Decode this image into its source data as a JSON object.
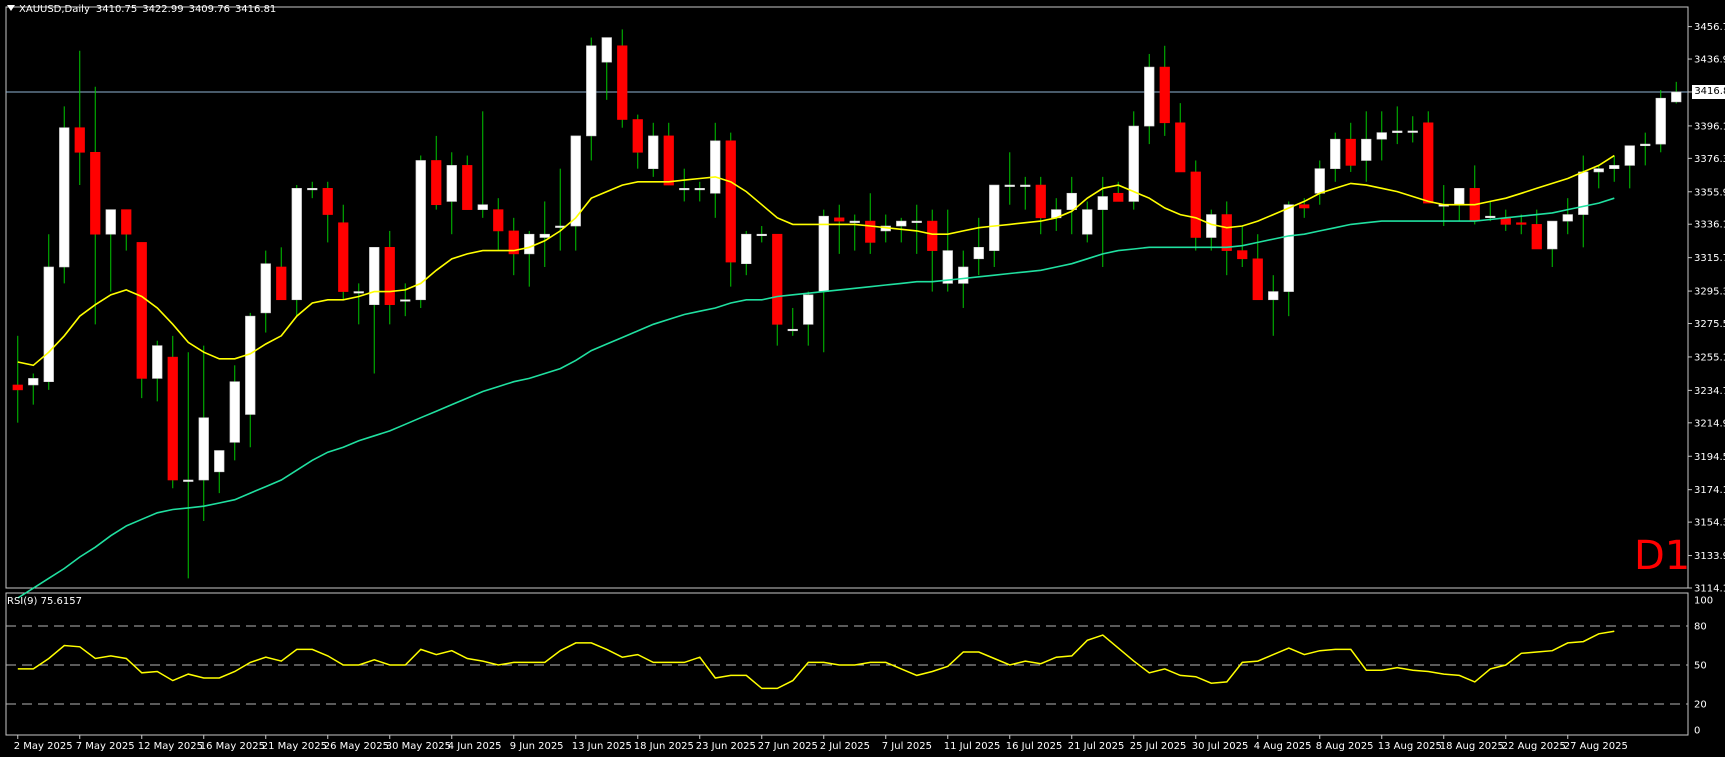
{
  "header": {
    "symbol": "XAUUSD,Daily",
    "open": "3410.75",
    "high": "3422.99",
    "low": "3409.76",
    "close": "3416.81"
  },
  "timeframe_label": "D1",
  "last_price_label": "3416.81",
  "rsi_header": "RSI(9) 75.6157",
  "colors": {
    "background": "#000000",
    "bull_candle": "#ffffff",
    "bear_candle": "#ff0000",
    "wick": "#00c800",
    "ma_fast": "#ffff00",
    "ma_slow": "#20e0a0",
    "rsi_line": "#ffff00",
    "grid_dash": "#b4b4b4",
    "price_line": "#8fb5d5"
  },
  "chart_data": [
    {
      "type": "candlestick",
      "title": "XAUUSD,Daily",
      "ylim": [
        3114.1,
        3465.0
      ],
      "y_ticks": [
        "3456.70",
        "3436.90",
        "3416.81",
        "3396.10",
        "3376.30",
        "3355.90",
        "3336.10",
        "3315.70",
        "3295.30",
        "3275.50",
        "3255.10",
        "3234.70",
        "3214.90",
        "3194.50",
        "3174.10",
        "3154.30",
        "3133.90",
        "3114.10"
      ],
      "x_labels": [
        "2 May 2025",
        "7 May 2025",
        "12 May 2025",
        "16 May 2025",
        "21 May 2025",
        "26 May 2025",
        "30 May 2025",
        "4 Jun 2025",
        "9 Jun 2025",
        "13 Jun 2025",
        "18 Jun 2025",
        "23 Jun 2025",
        "27 Jun 2025",
        "2 Jul 2025",
        "7 Jul 2025",
        "11 Jul 2025",
        "16 Jul 2025",
        "21 Jul 2025",
        "25 Jul 2025",
        "30 Jul 2025",
        "4 Aug 2025",
        "8 Aug 2025",
        "13 Aug 2025",
        "18 Aug 2025",
        "22 Aug 2025",
        "27 Aug 2025"
      ],
      "x_label_bar_index": [
        0,
        4,
        8,
        12,
        16,
        20,
        24,
        28,
        32,
        36,
        40,
        44,
        48,
        52,
        56,
        60,
        64,
        68,
        72,
        76,
        80,
        84,
        88,
        92,
        96,
        100
      ],
      "series": [
        {
          "name": "XAUUSD",
          "ohlc": [
            [
              3238,
              3268,
              3215,
              3235
            ],
            [
              3238,
              3245,
              3226,
              3242
            ],
            [
              3240,
              3330,
              3235,
              3310
            ],
            [
              3310,
              3408,
              3300,
              3395
            ],
            [
              3395,
              3442,
              3360,
              3380
            ],
            [
              3380,
              3420,
              3275,
              3330
            ],
            [
              3330,
              3345,
              3295,
              3345
            ],
            [
              3345,
              3345,
              3320,
              3330
            ],
            [
              3325,
              3325,
              3230,
              3242
            ],
            [
              3242,
              3265,
              3228,
              3262
            ],
            [
              3255,
              3268,
              3175,
              3180
            ],
            [
              3180,
              3258,
              3120,
              3180
            ],
            [
              3180,
              3262,
              3155,
              3218
            ],
            [
              3185,
              3198,
              3172,
              3198
            ],
            [
              3203,
              3250,
              3192,
              3240
            ],
            [
              3220,
              3282,
              3200,
              3280
            ],
            [
              3282,
              3320,
              3270,
              3312
            ],
            [
              3310,
              3322,
              3290,
              3290
            ],
            [
              3290,
              3360,
              3280,
              3358
            ],
            [
              3358,
              3362,
              3352,
              3358
            ],
            [
              3358,
              3362,
              3325,
              3342
            ],
            [
              3337,
              3348,
              3290,
              3295
            ],
            [
              3295,
              3300,
              3275,
              3295
            ],
            [
              3287,
              3322,
              3245,
              3322
            ],
            [
              3322,
              3332,
              3275,
              3287
            ],
            [
              3290,
              3300,
              3280,
              3290
            ],
            [
              3290,
              3378,
              3285,
              3375
            ],
            [
              3375,
              3390,
              3345,
              3348
            ],
            [
              3350,
              3380,
              3330,
              3372
            ],
            [
              3372,
              3378,
              3345,
              3345
            ],
            [
              3345,
              3405,
              3340,
              3348
            ],
            [
              3345,
              3352,
              3320,
              3332
            ],
            [
              3332,
              3340,
              3305,
              3318
            ],
            [
              3318,
              3332,
              3298,
              3330
            ],
            [
              3328,
              3350,
              3310,
              3330
            ],
            [
              3335,
              3370,
              3320,
              3335
            ],
            [
              3335,
              3390,
              3320,
              3390
            ],
            [
              3390,
              3450,
              3375,
              3445
            ],
            [
              3435,
              3445,
              3412,
              3450
            ],
            [
              3445,
              3455,
              3395,
              3400
            ],
            [
              3400,
              3403,
              3370,
              3380
            ],
            [
              3370,
              3398,
              3365,
              3390
            ],
            [
              3390,
              3398,
              3360,
              3360
            ],
            [
              3358,
              3370,
              3350,
              3358
            ],
            [
              3358,
              3362,
              3350,
              3358
            ],
            [
              3355,
              3398,
              3340,
              3387
            ],
            [
              3387,
              3392,
              3298,
              3313
            ],
            [
              3312,
              3332,
              3305,
              3330
            ],
            [
              3330,
              3335,
              3325,
              3330
            ],
            [
              3330,
              3330,
              3262,
              3275
            ],
            [
              3272,
              3285,
              3268,
              3272
            ],
            [
              3275,
              3295,
              3262,
              3293
            ],
            [
              3295,
              3345,
              3258,
              3341
            ],
            [
              3340,
              3348,
              3318,
              3338
            ],
            [
              3338,
              3342,
              3320,
              3338
            ],
            [
              3338,
              3355,
              3318,
              3325
            ],
            [
              3332,
              3342,
              3325,
              3335
            ],
            [
              3335,
              3340,
              3325,
              3338
            ],
            [
              3338,
              3348,
              3318,
              3338
            ],
            [
              3338,
              3345,
              3295,
              3320
            ],
            [
              3300,
              3345,
              3295,
              3320
            ],
            [
              3300,
              3320,
              3285,
              3310
            ],
            [
              3315,
              3340,
              3305,
              3322
            ],
            [
              3320,
              3350,
              3310,
              3360
            ],
            [
              3360,
              3380,
              3348,
              3360
            ],
            [
              3360,
              3365,
              3345,
              3360
            ],
            [
              3360,
              3365,
              3330,
              3340
            ],
            [
              3340,
              3352,
              3332,
              3345
            ],
            [
              3345,
              3365,
              3330,
              3355
            ],
            [
              3330,
              3350,
              3325,
              3345
            ],
            [
              3345,
              3365,
              3310,
              3353
            ],
            [
              3355,
              3362,
              3350,
              3350
            ],
            [
              3350,
              3405,
              3345,
              3396
            ],
            [
              3396,
              3440,
              3385,
              3432
            ],
            [
              3432,
              3445,
              3390,
              3398
            ],
            [
              3398,
              3410,
              3380,
              3368
            ],
            [
              3368,
              3375,
              3320,
              3328
            ],
            [
              3328,
              3345,
              3320,
              3342
            ],
            [
              3342,
              3350,
              3305,
              3320
            ],
            [
              3320,
              3335,
              3310,
              3315
            ],
            [
              3315,
              3330,
              3295,
              3290
            ],
            [
              3290,
              3305,
              3268,
              3295
            ],
            [
              3295,
              3350,
              3280,
              3348
            ],
            [
              3348,
              3352,
              3340,
              3346
            ],
            [
              3355,
              3375,
              3348,
              3370
            ],
            [
              3370,
              3392,
              3362,
              3388
            ],
            [
              3388,
              3398,
              3368,
              3372
            ],
            [
              3375,
              3405,
              3362,
              3388
            ],
            [
              3388,
              3405,
              3375,
              3392
            ],
            [
              3392,
              3408,
              3385,
              3393
            ],
            [
              3393,
              3402,
              3386,
              3393
            ],
            [
              3398,
              3405,
              3350,
              3349
            ],
            [
              3348,
              3360,
              3335,
              3348
            ],
            [
              3348,
              3358,
              3338,
              3358
            ],
            [
              3358,
              3372,
              3336,
              3338
            ],
            [
              3341,
              3350,
              3338,
              3341
            ],
            [
              3340,
              3345,
              3332,
              3336
            ],
            [
              3337,
              3342,
              3330,
              3336
            ],
            [
              3336,
              3345,
              3322,
              3321
            ],
            [
              3321,
              3335,
              3310,
              3338
            ],
            [
              3338,
              3352,
              3330,
              3342
            ],
            [
              3342,
              3378,
              3322,
              3368
            ],
            [
              3368,
              3372,
              3358,
              3370
            ],
            [
              3370,
              3378,
              3362,
              3372
            ],
            [
              3372,
              3382,
              3358,
              3384
            ],
            [
              3384,
              3392,
              3372,
              3385
            ],
            [
              3385,
              3418,
              3380,
              3413
            ],
            [
              3410.75,
              3422.99,
              3409.76,
              3416.81
            ]
          ]
        },
        {
          "name": "MA fast",
          "values": [
            3252,
            3250,
            3258,
            3268,
            3280,
            3287,
            3293,
            3296,
            3292,
            3285,
            3275,
            3264,
            3258,
            3254,
            3254,
            3257,
            3263,
            3268,
            3280,
            3288,
            3290,
            3290,
            3292,
            3295,
            3295,
            3296,
            3300,
            3308,
            3315,
            3318,
            3320,
            3320,
            3320,
            3322,
            3326,
            3332,
            3340,
            3352,
            3356,
            3360,
            3362,
            3362,
            3362,
            3363,
            3364,
            3365,
            3362,
            3356,
            3348,
            3340,
            3336,
            3336,
            3336,
            3336,
            3336,
            3335,
            3334,
            3333,
            3332,
            3330,
            3330,
            3332,
            3334,
            3335,
            3336,
            3337,
            3338,
            3340,
            3344,
            3352,
            3358,
            3360,
            3356,
            3352,
            3346,
            3342,
            3340,
            3336,
            3334,
            3335,
            3338,
            3342,
            3346,
            3350,
            3355,
            3358,
            3361,
            3360,
            3358,
            3356,
            3353,
            3350,
            3348,
            3348,
            3348,
            3350,
            3352,
            3355,
            3358,
            3361,
            3364,
            3368,
            3372,
            3378
          ]
        },
        {
          "name": "MA slow",
          "values": [
            3108,
            3114,
            3120,
            3126,
            3133,
            3139,
            3146,
            3152,
            3156,
            3160,
            3162,
            3163,
            3164,
            3166,
            3168,
            3172,
            3176,
            3180,
            3186,
            3192,
            3197,
            3200,
            3204,
            3207,
            3210,
            3214,
            3218,
            3222,
            3226,
            3230,
            3234,
            3237,
            3240,
            3242,
            3245,
            3248,
            3253,
            3259,
            3263,
            3267,
            3271,
            3275,
            3278,
            3281,
            3283,
            3285,
            3288,
            3290,
            3290,
            3292,
            3293,
            3294,
            3295,
            3296,
            3297,
            3298,
            3299,
            3300,
            3301,
            3301,
            3302,
            3303,
            3304,
            3305,
            3306,
            3307,
            3308,
            3310,
            3312,
            3315,
            3318,
            3320,
            3321,
            3322,
            3322,
            3322,
            3322,
            3322,
            3322,
            3323,
            3325,
            3327,
            3329,
            3330,
            3332,
            3334,
            3336,
            3337,
            3338,
            3338,
            3338,
            3338,
            3338,
            3338,
            3338,
            3339,
            3340,
            3341,
            3342,
            3343,
            3345,
            3347,
            3349,
            3352
          ]
        }
      ]
    },
    {
      "type": "line",
      "title": "RSI(9) 75.6157",
      "ylim": [
        0,
        100
      ],
      "y_ticks": [
        "100",
        "80",
        "50",
        "20",
        "0"
      ],
      "levels": [
        80,
        50,
        20
      ],
      "series": [
        {
          "name": "RSI(9)",
          "values": [
            47,
            47,
            55,
            65,
            64,
            55,
            57,
            55,
            44,
            45,
            38,
            43,
            40,
            40,
            45,
            52,
            56,
            53,
            62,
            62,
            57,
            50,
            50,
            54,
            50,
            50,
            62,
            58,
            61,
            55,
            53,
            50,
            52,
            52,
            52,
            61,
            67,
            67,
            62,
            56,
            58,
            52,
            52,
            52,
            56,
            40,
            42,
            42,
            32,
            32,
            38,
            52,
            52,
            50,
            50,
            52,
            52,
            47,
            42,
            45,
            49,
            60,
            60,
            55,
            50,
            53,
            51,
            56,
            57,
            69,
            73,
            63,
            53,
            44,
            47,
            42,
            41,
            36,
            37,
            52,
            53,
            58,
            63,
            58,
            61,
            62,
            62,
            46,
            46,
            48,
            46,
            45,
            43,
            42,
            37,
            47,
            50,
            59,
            60,
            61,
            67,
            68,
            74,
            76
          ]
        }
      ]
    }
  ]
}
